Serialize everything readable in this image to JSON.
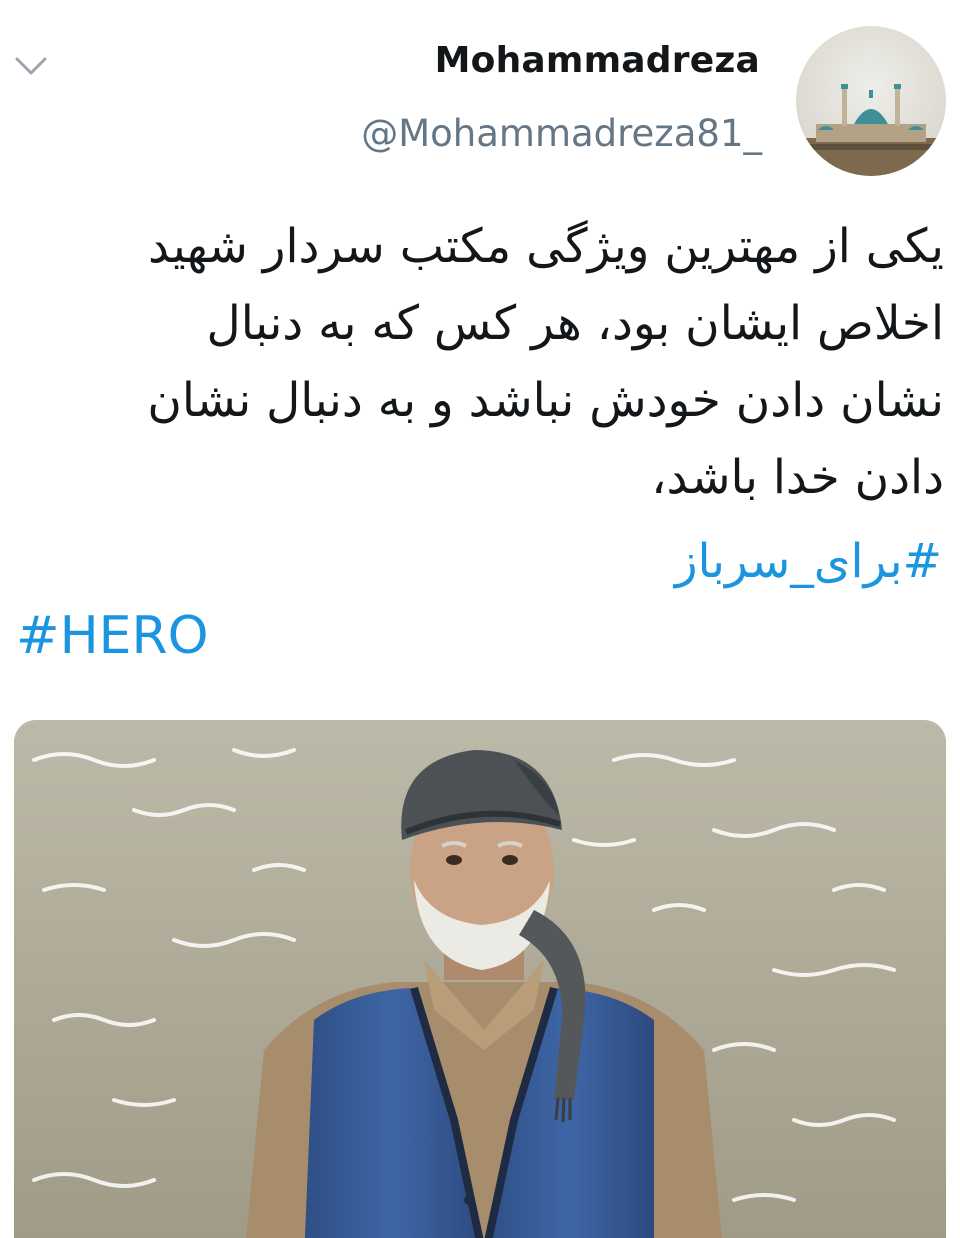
{
  "tweet": {
    "display_name": "Mohammadreza",
    "handle": "@Mohammadreza81_",
    "text_lines": [
      "یکی از مهترین ویژگی مکتب سردار شهید",
      "اخلاص ایشان بود، هر کس که به دنبال",
      "نشان دادن خودش نباشد و به دنبال نشان",
      "دادن خدا باشد،"
    ],
    "hashtags": [
      "#برای_سرباز",
      "#HERO"
    ]
  },
  "icons": {
    "menu": "chevron-down-icon"
  },
  "colors": {
    "text": "#14171a",
    "secondary": "#657786",
    "link": "#1b95e0",
    "background": "#ffffff"
  }
}
